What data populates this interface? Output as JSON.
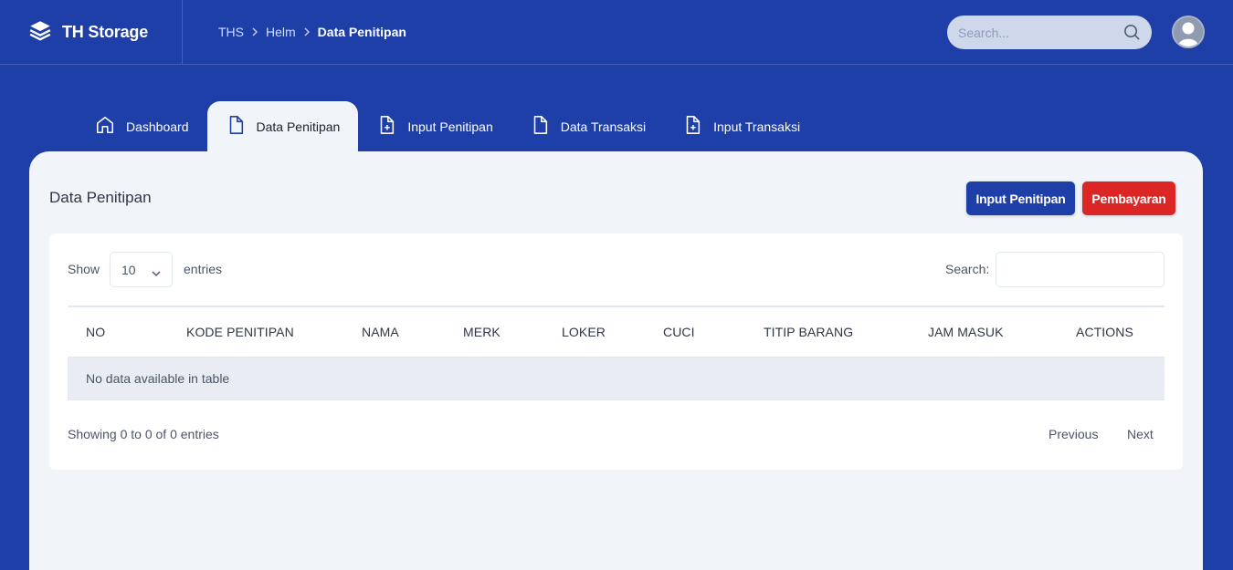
{
  "app": {
    "name": "TH Storage"
  },
  "breadcrumb": [
    "THS",
    "Helm",
    "Data Penitipan"
  ],
  "search": {
    "placeholder": "Search..."
  },
  "tabs": [
    {
      "label": "Dashboard",
      "icon": "home-icon"
    },
    {
      "label": "Data Penitipan",
      "icon": "file-icon",
      "active": true
    },
    {
      "label": "Input Penitipan",
      "icon": "file-plus-icon"
    },
    {
      "label": "Data Transaksi",
      "icon": "file-icon"
    },
    {
      "label": "Input Transaksi",
      "icon": "file-plus-icon"
    }
  ],
  "page": {
    "title": "Data Penitipan",
    "btn_input": "Input Penitipan",
    "btn_pay": "Pembayaran"
  },
  "table": {
    "show_label": "Show",
    "length_value": "10",
    "entries_label": "entries",
    "search_label": "Search:",
    "columns": [
      "NO",
      "KODE PENITIPAN",
      "NAMA",
      "MERK",
      "LOKER",
      "CUCI",
      "TITIP BARANG",
      "JAM MASUK",
      "ACTIONS"
    ],
    "empty": "No data available in table",
    "info": "Showing 0 to 0 of 0 entries",
    "prev": "Previous",
    "next": "Next"
  },
  "colors": {
    "brand": "#1e3ea8",
    "danger": "#dc2626",
    "panel": "#f1f4f8"
  }
}
